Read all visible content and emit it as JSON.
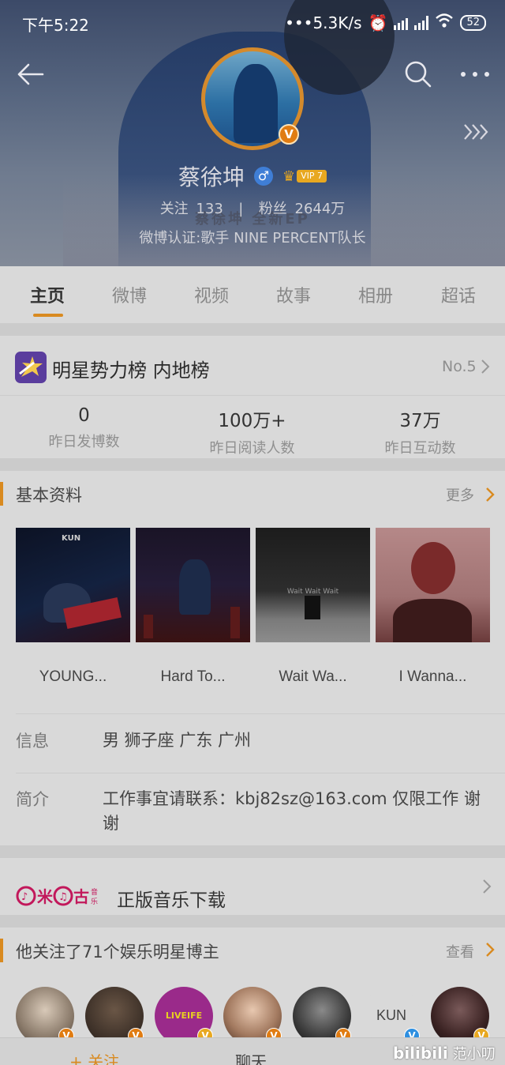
{
  "status_bar": {
    "time": "下午5:22",
    "network_speed": "•••5.3K/s",
    "battery": "52"
  },
  "profile": {
    "name": "蔡徐坤",
    "vip_label": "VIP 7",
    "follow_label": "关注",
    "follow_count": "133",
    "separator": "|",
    "fans_label": "粉丝",
    "fans_count": "2644万",
    "overlay_text": "蔡徐坤  全新EP",
    "verification": "微博认证:歌手 NINE PERCENT队长",
    "verified_badge": "V"
  },
  "tabs": [
    "主页",
    "微博",
    "视频",
    "故事",
    "相册",
    "超话"
  ],
  "star_rank": {
    "title": "明星势力榜  内地榜",
    "rank": "No.5",
    "stats": [
      {
        "value": "0",
        "label": "昨日发博数"
      },
      {
        "value": "100万+",
        "label": "昨日阅读人数"
      },
      {
        "value": "37万",
        "label": "昨日互动数"
      }
    ]
  },
  "basic_info": {
    "title": "基本资料",
    "more": "更多",
    "albums": [
      {
        "name": "YOUNG...",
        "cover_text": "KUN"
      },
      {
        "name": "Hard To...",
        "cover_text": ""
      },
      {
        "name": "Wait Wa...",
        "cover_text": "Wait Wait Wait"
      },
      {
        "name": "I Wanna...",
        "cover_text": ""
      }
    ],
    "info_label": "信息",
    "info_value": "男 狮子座 广东 广州",
    "intro_label": "简介",
    "intro_value": "工作事宜请联系：kbj82sz@163.com 仅限工作 谢谢"
  },
  "music": {
    "logo_text": "咪咕音乐",
    "title": "正版音乐下载"
  },
  "following": {
    "title": "他关注了71个娱乐明星博主",
    "more": "查看",
    "avatars": [
      {
        "badge": "V"
      },
      {
        "badge": "V"
      },
      {
        "badge": "V",
        "text": "LIVEIFE"
      },
      {
        "badge": "V"
      },
      {
        "badge": "V"
      },
      {
        "badge": "V",
        "text": "KUN"
      },
      {
        "badge": "V"
      }
    ]
  },
  "bottom_bar": {
    "follow": "+ 关注",
    "chat": "聊天"
  },
  "watermark": {
    "site": "bilibili",
    "author": "范小叨叨"
  },
  "colors": {
    "accent": "#d98a20",
    "verified_orange": "#e07c12",
    "verified_blue": "#2e8fe0",
    "vip_gold": "#e8a820"
  }
}
